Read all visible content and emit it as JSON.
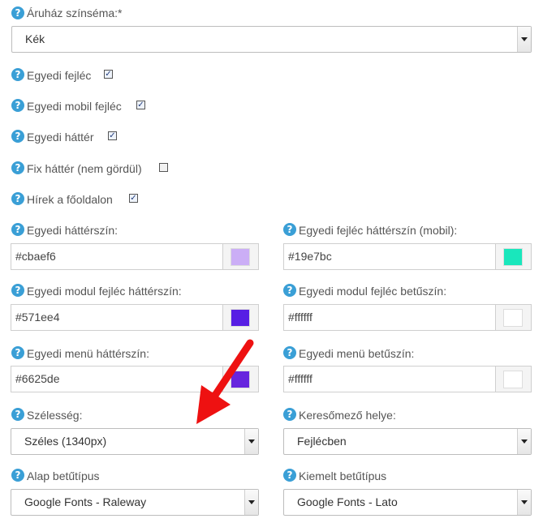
{
  "theme": {
    "label": "Áruház színséma:*",
    "value": "Kék"
  },
  "checkboxes": [
    {
      "label": "Egyedi fejléc",
      "checked": true
    },
    {
      "label": "Egyedi mobil fejléc",
      "checked": true
    },
    {
      "label": "Egyedi háttér",
      "checked": true
    },
    {
      "label": "Fix háttér (nem gördül)",
      "checked": false
    },
    {
      "label": "Hírek a főoldalon",
      "checked": true
    }
  ],
  "colors": [
    {
      "label": "Egyedi háttérszín:",
      "value": "#cbaef6",
      "swatch": "#cbaef6"
    },
    {
      "label": "Egyedi fejléc háttérszín (mobil):",
      "value": "#19e7bc",
      "swatch": "#19e7bc"
    },
    {
      "label": "Egyedi modul fejléc háttérszín:",
      "value": "#571ee4",
      "swatch": "#571ee4"
    },
    {
      "label": "Egyedi modul fejléc betűszín:",
      "value": "#ffffff",
      "swatch": "#ffffff"
    },
    {
      "label": "Egyedi menü háttérszín:",
      "value": "#6625de",
      "swatch": "#6625de"
    },
    {
      "label": "Egyedi menü betűszín:",
      "value": "#ffffff",
      "swatch": "#ffffff"
    }
  ],
  "selects": [
    {
      "label": "Szélesség:",
      "value": "Széles (1340px)"
    },
    {
      "label": "Keresőmező helye:",
      "value": "Fejlécben"
    },
    {
      "label": "Alap betűtípus",
      "value": "Google Fonts - Raleway"
    },
    {
      "label": "Kiemelt betűtípus",
      "value": "Google Fonts - Lato"
    }
  ],
  "help_glyph": "?",
  "check_glyph": "✓",
  "accent_color": "#3a9fd6",
  "annotation": {
    "icon": "red-arrow-icon",
    "color": "#ee1111"
  }
}
